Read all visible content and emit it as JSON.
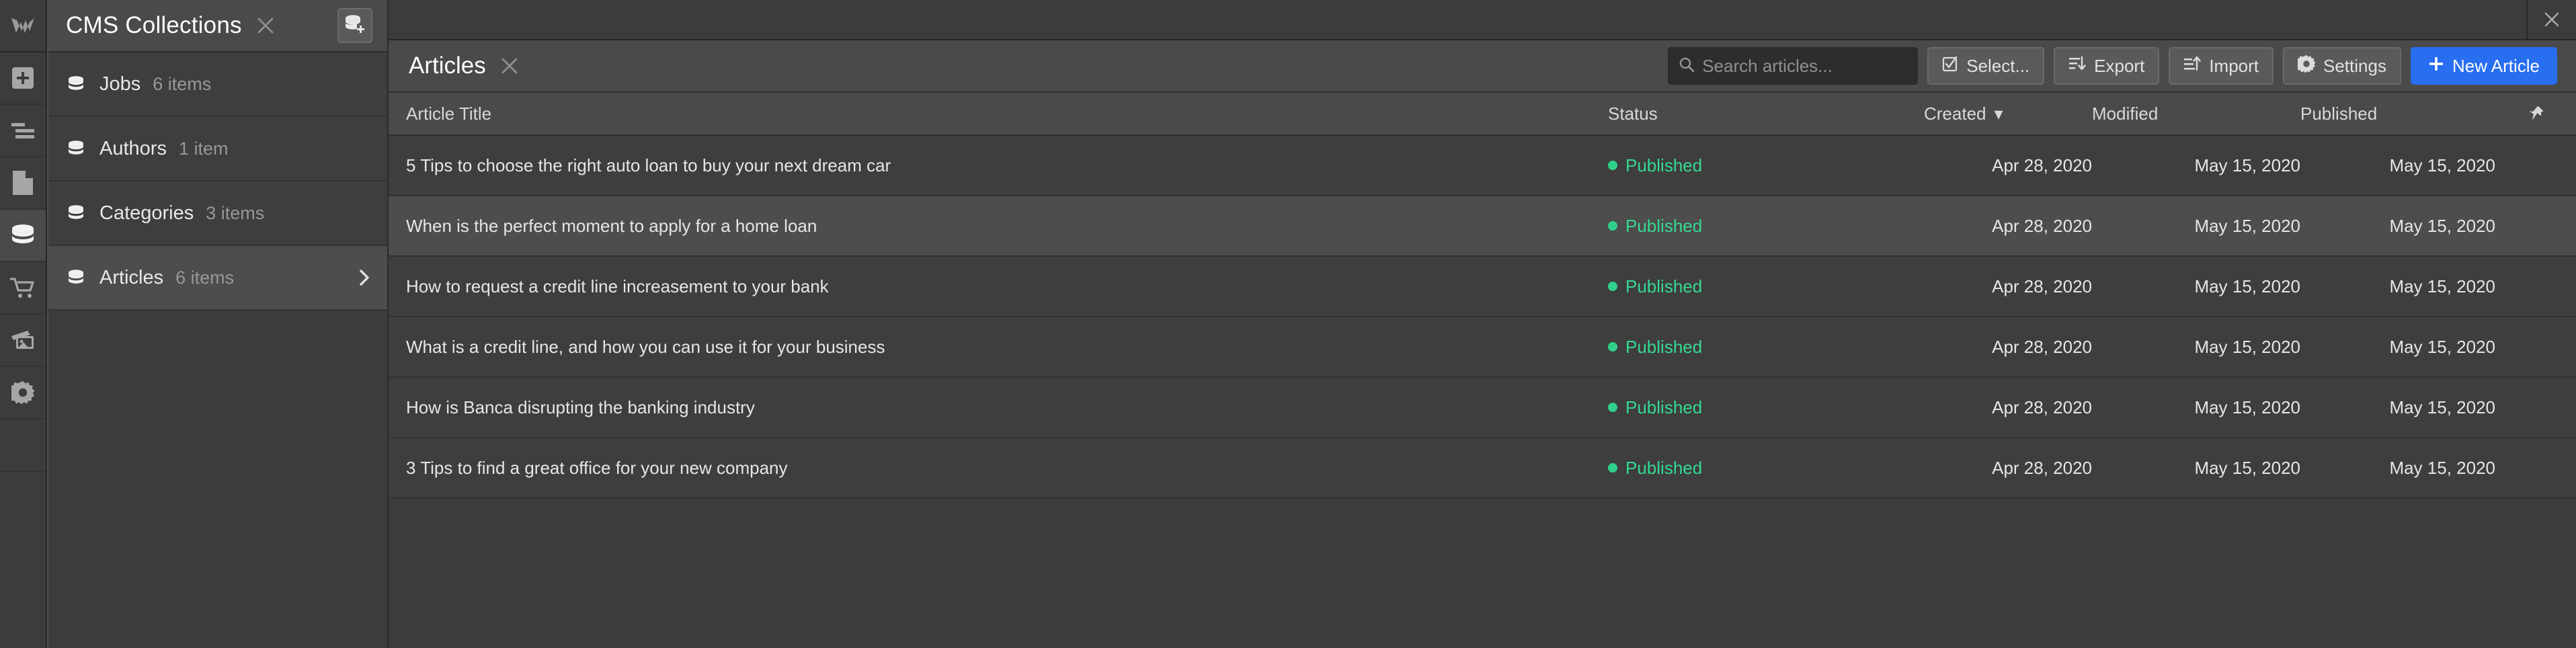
{
  "app": {
    "logo_icon": "webflow-logo-icon",
    "window_close_icon": "close-icon"
  },
  "rail": {
    "items": [
      {
        "name": "webflow-logo",
        "icon": "webflow-logo-icon",
        "active": false
      },
      {
        "name": "add-element",
        "icon": "plus-square-icon",
        "active": false
      },
      {
        "name": "navigator",
        "icon": "navigator-icon",
        "active": false
      },
      {
        "name": "pages",
        "icon": "page-icon",
        "active": false
      },
      {
        "name": "cms",
        "icon": "database-icon",
        "active": true
      },
      {
        "name": "ecommerce",
        "icon": "shopping-cart-icon",
        "active": false
      },
      {
        "name": "assets",
        "icon": "images-icon",
        "active": false
      },
      {
        "name": "settings",
        "icon": "gear-icon",
        "active": false
      }
    ]
  },
  "collections_panel": {
    "title": "CMS Collections",
    "close_icon": "close-icon",
    "new_collection_icon": "database-plus-icon",
    "items": [
      {
        "label": "Jobs",
        "count": "6 items",
        "selected": false,
        "chevron": false
      },
      {
        "label": "Authors",
        "count": "1 item",
        "selected": false,
        "chevron": false
      },
      {
        "label": "Categories",
        "count": "3 items",
        "selected": false,
        "chevron": false
      },
      {
        "label": "Articles",
        "count": "6 items",
        "selected": true,
        "chevron": true
      }
    ]
  },
  "main": {
    "title": "Articles",
    "close_icon": "close-icon",
    "search": {
      "placeholder": "Search articles...",
      "value": "",
      "icon": "search-icon"
    },
    "buttons": [
      {
        "label": "Select...",
        "icon": "checkbox-checked-icon",
        "primary": false
      },
      {
        "label": "Export",
        "icon": "export-icon",
        "primary": false
      },
      {
        "label": "Import",
        "icon": "import-icon",
        "primary": false
      },
      {
        "label": "Settings",
        "icon": "gear-icon",
        "primary": false
      },
      {
        "label": "New Article",
        "icon": "plus-icon",
        "primary": true
      }
    ]
  },
  "table": {
    "columns": {
      "title": "Article Title",
      "status": "Status",
      "created": "Created",
      "modified": "Modified",
      "published": "Published",
      "sort_indicator": "▾",
      "pin_icon": "pin-icon"
    },
    "sorted_by": "Created",
    "rows": [
      {
        "title": "5 Tips to choose the right auto loan to buy your next dream car",
        "status": "Published",
        "status_color": "#35d992",
        "created": "Apr 28, 2020",
        "modified": "May 15, 2020",
        "published": "May 15, 2020",
        "hover": false
      },
      {
        "title": "When is the perfect moment to apply for a home loan",
        "status": "Published",
        "status_color": "#35d992",
        "created": "Apr 28, 2020",
        "modified": "May 15, 2020",
        "published": "May 15, 2020",
        "hover": true
      },
      {
        "title": "How to request a credit line increasement to your bank",
        "status": "Published",
        "status_color": "#35d992",
        "created": "Apr 28, 2020",
        "modified": "May 15, 2020",
        "published": "May 15, 2020",
        "hover": false
      },
      {
        "title": "What is a credit line, and how you can use it for your business",
        "status": "Published",
        "status_color": "#35d992",
        "created": "Apr 28, 2020",
        "modified": "May 15, 2020",
        "published": "May 15, 2020",
        "hover": false
      },
      {
        "title": "How is Banca disrupting the banking industry",
        "status": "Published",
        "status_color": "#35d992",
        "created": "Apr 28, 2020",
        "modified": "May 15, 2020",
        "published": "May 15, 2020",
        "hover": false
      },
      {
        "title": "3 Tips to find a great office for your new company",
        "status": "Published",
        "status_color": "#35d992",
        "created": "Apr 28, 2020",
        "modified": "May 15, 2020",
        "published": "May 15, 2020",
        "hover": false
      }
    ]
  },
  "colors": {
    "accent": "#276ef1",
    "status_published": "#35d992",
    "panel_bg": "#3c3c3c",
    "header_bg": "#4a4a4a",
    "row_bg": "#3e3e3e",
    "row_hover_bg": "#4d4d4d"
  }
}
